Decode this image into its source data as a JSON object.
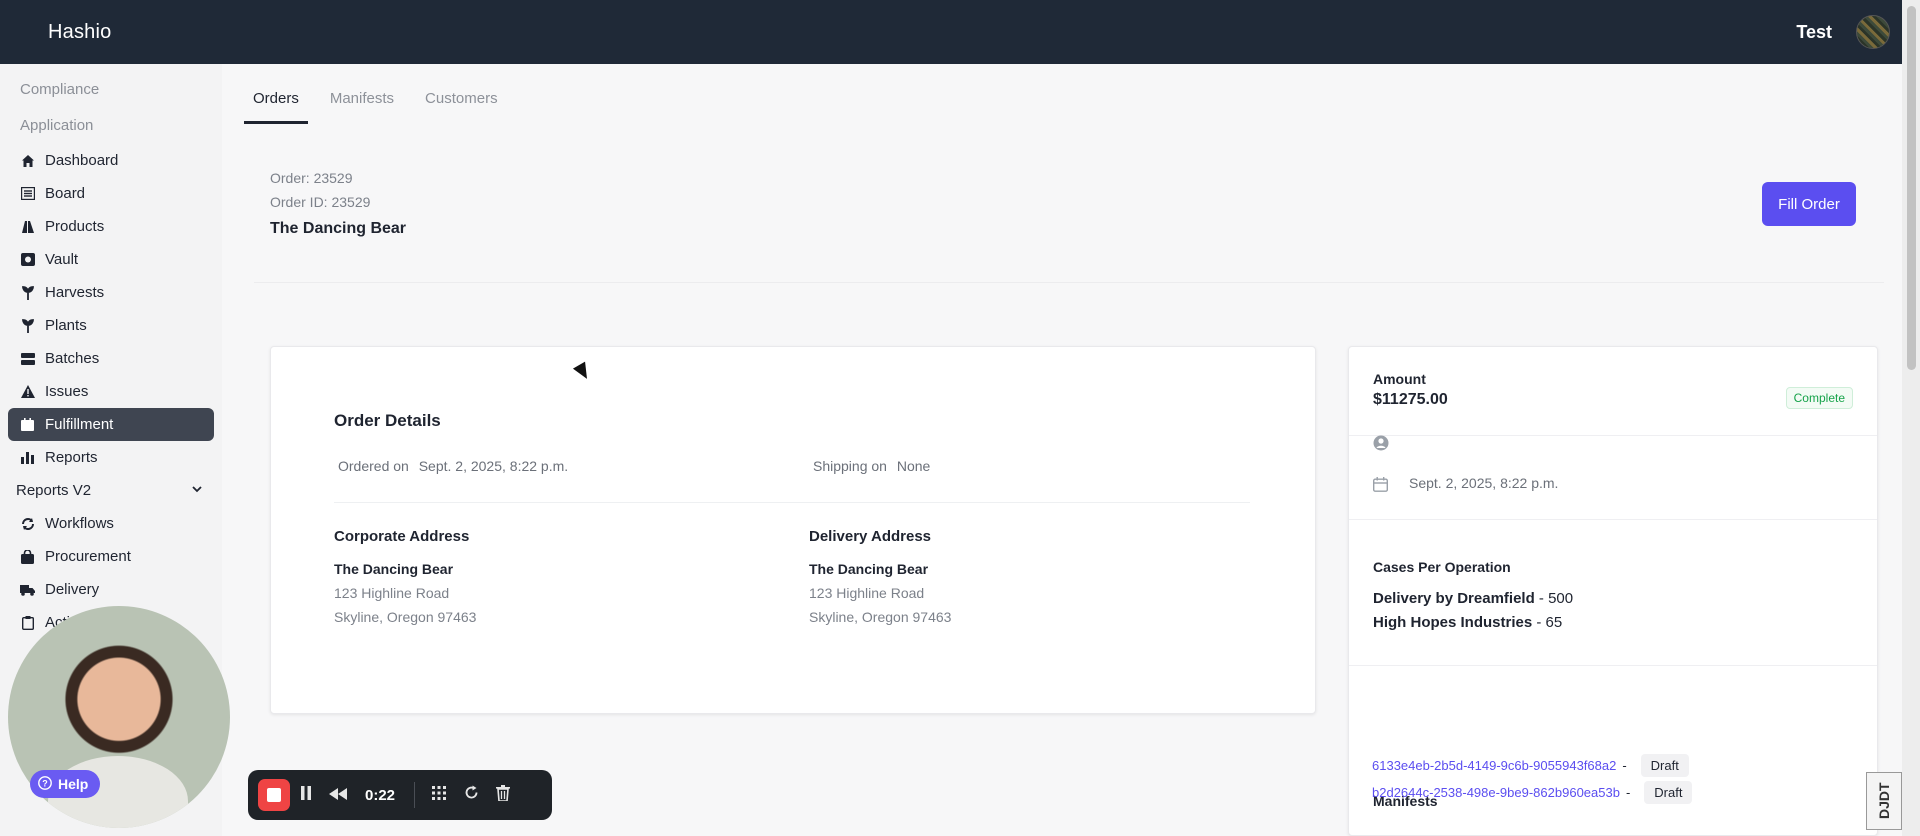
{
  "app": {
    "brand": "Hashio",
    "user_name": "Test"
  },
  "sidebar": {
    "sections": [
      "Compliance",
      "Application"
    ],
    "items": [
      {
        "label": "Dashboard",
        "icon": "home-icon"
      },
      {
        "label": "Board",
        "icon": "board-icon"
      },
      {
        "label": "Products",
        "icon": "products-icon"
      },
      {
        "label": "Vault",
        "icon": "vault-icon"
      },
      {
        "label": "Harvests",
        "icon": "harvest-icon"
      },
      {
        "label": "Plants",
        "icon": "plant-icon"
      },
      {
        "label": "Batches",
        "icon": "batches-icon"
      },
      {
        "label": "Issues",
        "icon": "warning-icon"
      },
      {
        "label": "Fulfillment",
        "icon": "fulfillment-icon",
        "active": true
      },
      {
        "label": "Reports",
        "icon": "bar-chart-icon"
      },
      {
        "label": "Reports V2",
        "icon": "chevron-down-icon"
      },
      {
        "label": "Workflows",
        "icon": "workflow-icon"
      },
      {
        "label": "Procurement",
        "icon": "bag-icon"
      },
      {
        "label": "Delivery",
        "icon": "truck-icon"
      },
      {
        "label": "Acti",
        "icon": "clipboard-icon"
      }
    ]
  },
  "tabs": [
    "Orders",
    "Manifests",
    "Customers"
  ],
  "order": {
    "order_line": "Order: 23529",
    "order_id_line": "Order ID: 23529",
    "customer": "The Dancing Bear",
    "fill_button": "Fill Order"
  },
  "details": {
    "title": "Order Details",
    "ordered_on_label": "Ordered on",
    "ordered_on_value": "Sept. 2, 2025, 8:22 p.m.",
    "shipping_on_label": "Shipping on",
    "shipping_on_value": "None",
    "corporate": {
      "label": "Corporate Address",
      "name": "The Dancing Bear",
      "street": "123 Highline Road",
      "city": "Skyline, Oregon 97463"
    },
    "delivery": {
      "label": "Delivery Address",
      "name": "The Dancing Bear",
      "street": "123 Highline Road",
      "city": "Skyline, Oregon 97463"
    }
  },
  "summary": {
    "amount_label": "Amount",
    "amount_value": "$11275.00",
    "status": "Complete",
    "date": "Sept. 2, 2025, 8:22 p.m.",
    "cases_label": "Cases Per Operation",
    "cases": [
      {
        "name": "Delivery by Dreamfield",
        "value": "500"
      },
      {
        "name": "High Hopes Industries",
        "value": "65"
      }
    ],
    "manifests_label": "Manifests",
    "manifests": [
      {
        "id": "6133e4eb-2b5d-4149-9c6b-9055943f68a2",
        "status": "Draft"
      },
      {
        "id": "b2d2644c-2538-498e-9be9-862b960ea53b",
        "status": "Draft"
      }
    ],
    "separator": "-"
  },
  "recorder": {
    "time": "0:22",
    "help_label": "Help"
  },
  "corner_logo": "DJDT",
  "colors": {
    "topbar": "#1f2937",
    "accent": "#5b4ef0",
    "complete": "#16a34a",
    "record": "#ef4444"
  }
}
